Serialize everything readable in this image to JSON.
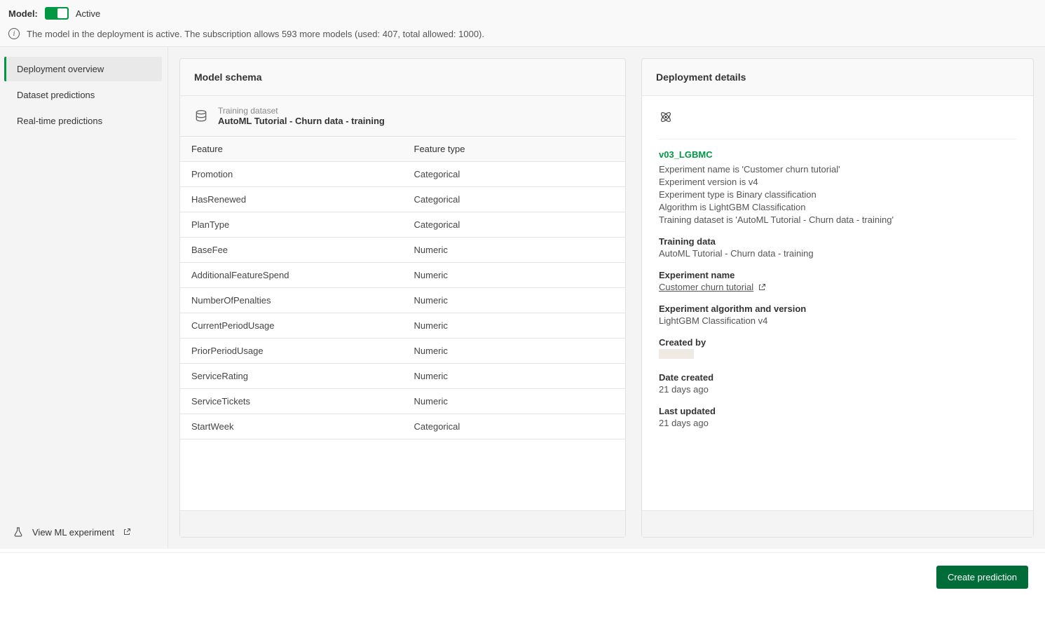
{
  "top": {
    "model_label": "Model:",
    "status": "Active",
    "info_text": "The model in the deployment is active. The subscription allows 593 more models (used: 407, total allowed: 1000)."
  },
  "sidebar": {
    "items": [
      {
        "label": "Deployment overview"
      },
      {
        "label": "Dataset predictions"
      },
      {
        "label": "Real-time predictions"
      }
    ],
    "footer": {
      "label": "View ML experiment"
    }
  },
  "schema": {
    "panel_title": "Model schema",
    "dataset_label": "Training dataset",
    "dataset_name": "AutoML Tutorial - Churn data - training",
    "col_feature": "Feature",
    "col_type": "Feature type",
    "rows": [
      {
        "feature": "Promotion",
        "type": "Categorical"
      },
      {
        "feature": "HasRenewed",
        "type": "Categorical"
      },
      {
        "feature": "PlanType",
        "type": "Categorical"
      },
      {
        "feature": "BaseFee",
        "type": "Numeric"
      },
      {
        "feature": "AdditionalFeatureSpend",
        "type": "Numeric"
      },
      {
        "feature": "NumberOfPenalties",
        "type": "Numeric"
      },
      {
        "feature": "CurrentPeriodUsage",
        "type": "Numeric"
      },
      {
        "feature": "PriorPeriodUsage",
        "type": "Numeric"
      },
      {
        "feature": "ServiceRating",
        "type": "Numeric"
      },
      {
        "feature": "ServiceTickets",
        "type": "Numeric"
      },
      {
        "feature": "StartWeek",
        "type": "Categorical"
      }
    ]
  },
  "details": {
    "panel_title": "Deployment details",
    "model_name": "v03_LGBMC",
    "lines": [
      "Experiment name is 'Customer churn tutorial'",
      "Experiment version is v4",
      "Experiment type is Binary classification",
      "Algorithm is LightGBM Classification",
      "Training dataset is 'AutoML Tutorial - Churn data - training'"
    ],
    "sections": {
      "training_data": {
        "label": "Training data",
        "value": "AutoML Tutorial - Churn data - training"
      },
      "experiment_name": {
        "label": "Experiment name",
        "value": "Customer churn tutorial"
      },
      "algorithm": {
        "label": "Experiment algorithm and version",
        "value": "LightGBM Classification v4"
      },
      "created_by": {
        "label": "Created by"
      },
      "date_created": {
        "label": "Date created",
        "value": "21 days ago"
      },
      "last_updated": {
        "label": "Last updated",
        "value": "21 days ago"
      }
    }
  },
  "footer": {
    "create_label": "Create prediction"
  }
}
